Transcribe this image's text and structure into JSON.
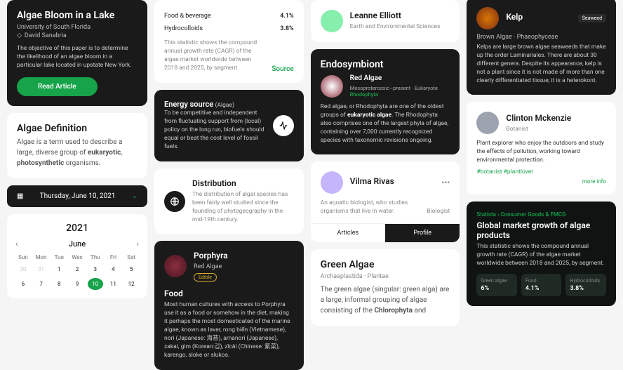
{
  "hero": {
    "title": "Algae Bloom in a Lake",
    "university": "University of South Florida",
    "author": "David Sanabria",
    "desc": "The objective of this paper is to determine the likelihood of an algae bloom in a particular lake located in upstate New York.",
    "button": "Read Article"
  },
  "definition": {
    "title": "Algae Definition",
    "pre": "Algae is a term used to describe a large, diverse group of ",
    "bold1": "eukaryotic",
    "mid": ", ",
    "bold2": "photosynthetic",
    "post": " organisms."
  },
  "date": "Thursday, June 10, 2021",
  "cal": {
    "year": "2021",
    "month": "June",
    "dow": [
      "Sun",
      "Mon",
      "Tue",
      "Wes",
      "Thu",
      "Fri",
      "Sat"
    ],
    "days": [
      {
        "n": "30",
        "m": true
      },
      {
        "n": "31",
        "m": true
      },
      {
        "n": "1"
      },
      {
        "n": "2"
      },
      {
        "n": "3"
      },
      {
        "n": "4"
      },
      {
        "n": "5"
      },
      {
        "n": "6"
      },
      {
        "n": "7"
      },
      {
        "n": "8"
      },
      {
        "n": "9"
      },
      {
        "n": "10",
        "a": true
      },
      {
        "n": "11"
      },
      {
        "n": "12"
      }
    ]
  },
  "chart_data": {
    "type": "table",
    "title": "Compound annual growth rate of algae market 2018–2025 by segment",
    "categories": [
      "Food & beverage",
      "Hydrocolloids"
    ],
    "values": [
      4.1,
      3.8
    ],
    "unit": "%"
  },
  "stats": {
    "rows": [
      {
        "l": "Food & beverage",
        "v": "4.1%"
      },
      {
        "l": "Hydrocolloids",
        "v": "3.8%"
      }
    ],
    "desc": "This statistic shows the compound annual growth rate (CAGR) of the algae market worldwide between 2018 and 2025, by segment.",
    "source": "Source"
  },
  "energy": {
    "title": "Energy source",
    "tag": "(Algae)",
    "desc": "To be competitive and independent from fluctuating support from (local) policy on the long run, biofuels should equal or beat the cost level of fossil fuels."
  },
  "dist": {
    "title": "Distribution",
    "desc": "The distribution of algal species has been fairly well studied since the founding of phytogeography in the mid-19th century."
  },
  "porphyra": {
    "name": "Porphyra",
    "type": "Red Algae",
    "badge": "Edible",
    "heading": "Food",
    "desc": "Most human cultures with access to Porphyra use it as a food or somehow in the diet, making it perhaps the most domesticated of the marine algae, known as laver, rong biển (Vietnamese), nori (Japanese: 海苔), amanori (Japanese), zakai, gim (Korean:김), zǐcài (Chinese: 紫菜), karengo, sloke or slukos."
  },
  "leanne": {
    "name": "Leanne Elliott",
    "role": "Earth and Environmental Sciences"
  },
  "endo": {
    "title": "Endosymbiont",
    "name": "Red Algae",
    "meta": "Mesoproterozoic–present · Eukaryote",
    "phylum": "Rhodophyta",
    "desc_pre": "Red algae, or Rhodophyta are one of the oldest groups of ",
    "desc_bold": "eukaryotic algae",
    "desc_post": ". The Rhodophyta also comprises one of the largest phyla of algae, containing over 7,000 currently recognized species with taxonomic revisions ongoing."
  },
  "vilma": {
    "name": "Vilma Rivas",
    "desc": "An aquatic biologist, who studies organisms that live in water.",
    "role": "Biologist",
    "tab1": "Articles",
    "tab2": "Profile"
  },
  "green": {
    "title": "Green Algae",
    "sub": "Archaeplastida · Plantae",
    "pre": "The green algae (singular: green alga) are a large, informal grouping of algae consisting of the ",
    "b1": "Chlorophyta",
    "mid": " and "
  },
  "kelp": {
    "name": "Kelp",
    "tag": "Seaweed",
    "sub": "Brown Algae · Phaeophyceae",
    "desc": "Kelps are large brown algae seaweeds that make up the order Laminariales. There are about 30 different genera. Despite its appearance, kelp is not a plant since it is not made of more than one clearly differentiated tissue; it is a heterokont."
  },
  "clinton": {
    "name": "Clinton Mckenzie",
    "role": "Botanist",
    "desc": "Plant explorer who enjoy the outdoors and study the effects of pollution, working toward environmental protection.",
    "tags": [
      "#botanist",
      "#plantlover"
    ],
    "more": "more info"
  },
  "market": {
    "crumb": "Statista › Consumer Goods & FMCG",
    "title": "Global market growth of algae products",
    "desc": "This statistic shows the compound annual growth rate (CAGR) of the algae market worldwide between 2018 and 2025, by segment.",
    "stats": [
      {
        "l": "Green algae",
        "v": "6%"
      },
      {
        "l": "Food",
        "v": "4.1%"
      },
      {
        "l": "Hydrocolloids",
        "v": "3.8%"
      }
    ]
  }
}
